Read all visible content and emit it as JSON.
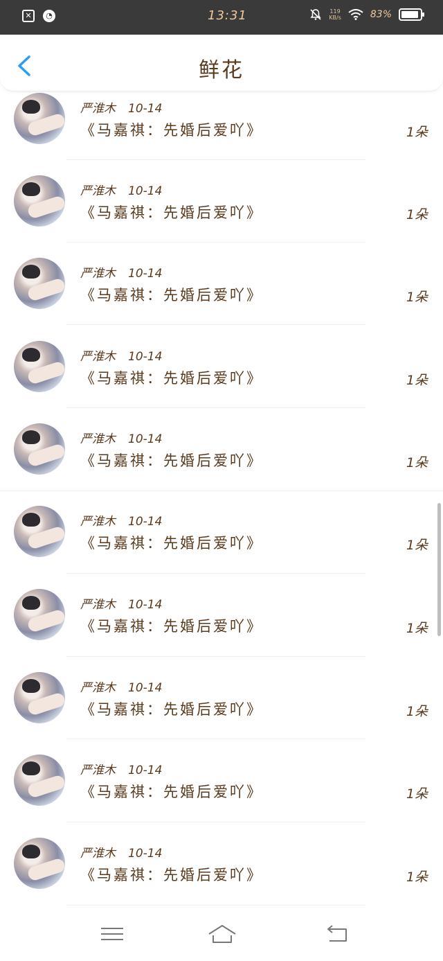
{
  "status_bar": {
    "time": "13:31",
    "network_speed": "119",
    "network_unit": "KB/s",
    "battery_percent": "83%",
    "icons": [
      "notification-x-icon",
      "speedometer-icon",
      "bell-off-icon",
      "wifi-icon",
      "battery-icon"
    ]
  },
  "header": {
    "title": "鲜花",
    "back_icon": "chevron-left-icon"
  },
  "list": {
    "items": [
      {
        "author": "严淮木",
        "date": "10-14",
        "book": "《马嘉祺：先婚后爱吖》",
        "qty": "1朵"
      },
      {
        "author": "严淮木",
        "date": "10-14",
        "book": "《马嘉祺：先婚后爱吖》",
        "qty": "1朵"
      },
      {
        "author": "严淮木",
        "date": "10-14",
        "book": "《马嘉祺：先婚后爱吖》",
        "qty": "1朵"
      },
      {
        "author": "严淮木",
        "date": "10-14",
        "book": "《马嘉祺：先婚后爱吖》",
        "qty": "1朵"
      },
      {
        "author": "严淮木",
        "date": "10-14",
        "book": "《马嘉祺：先婚后爱吖》",
        "qty": "1朵"
      },
      {
        "author": "严淮木",
        "date": "10-14",
        "book": "《马嘉祺：先婚后爱吖》",
        "qty": "1朵"
      },
      {
        "author": "严淮木",
        "date": "10-14",
        "book": "《马嘉祺：先婚后爱吖》",
        "qty": "1朵"
      },
      {
        "author": "严淮木",
        "date": "10-14",
        "book": "《马嘉祺：先婚后爱吖》",
        "qty": "1朵"
      },
      {
        "author": "严淮木",
        "date": "10-14",
        "book": "《马嘉祺：先婚后爱吖》",
        "qty": "1朵"
      },
      {
        "author": "严淮木",
        "date": "10-14",
        "book": "《马嘉祺：先婚后爱吖》",
        "qty": "1朵"
      }
    ]
  },
  "nav_bar": {
    "icons": [
      "menu-icon",
      "home-icon",
      "back-icon"
    ]
  },
  "colors": {
    "status_bar_bg": "#3a3a3a",
    "text_brown": "#5a3a1e",
    "accent_blue": "#2a9df4"
  }
}
